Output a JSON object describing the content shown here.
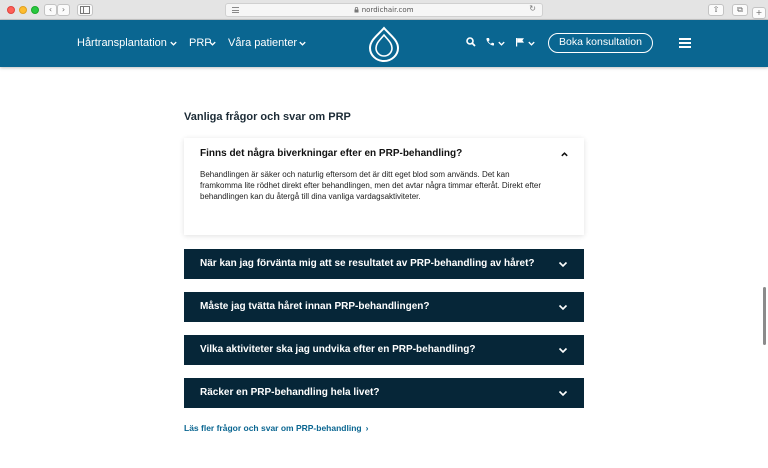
{
  "browser": {
    "url": "nordichair.com",
    "back_glyph": "‹",
    "forward_glyph": "›",
    "reload_glyph": "↻",
    "share_glyph": "⇧",
    "tabs_glyph": "⧉",
    "newtab_glyph": "+"
  },
  "header": {
    "nav": [
      {
        "label": "Hårtransplantation"
      },
      {
        "label": "PRP"
      },
      {
        "label": "Våra patienter"
      }
    ],
    "cta_label": "Boka konsultation",
    "colors": {
      "header_bg": "#0a6691",
      "row_bg": "#062638",
      "link": "#0a6691"
    },
    "icons": [
      "logo-drop-icon",
      "search-icon",
      "phone-icon",
      "flag-icon",
      "menu-icon"
    ]
  },
  "faq": {
    "title": "Vanliga frågor och svar om PRP",
    "open_item": {
      "question": "Finns det några biverkningar efter en PRP-behandling?",
      "answer": "Behandlingen är säker och naturlig eftersom det är ditt eget blod som används. Det kan framkomma lite rödhet direkt efter behandlingen, men det avtar några timmar efteråt. Direkt efter behandlingen kan du återgå till dina vanliga vardagsaktiviteter."
    },
    "items": [
      {
        "question": "När kan jag förvänta mig att se resultatet av PRP-behandling av håret?"
      },
      {
        "question": "Måste jag tvätta håret innan PRP-behandlingen?"
      },
      {
        "question": "Vilka aktiviteter ska jag undvika efter en PRP-behandling?"
      },
      {
        "question": "Räcker en PRP-behandling hela livet?"
      }
    ],
    "more_link": "Läs fler frågor och svar om PRP-behandling",
    "more_arrow": "›"
  }
}
